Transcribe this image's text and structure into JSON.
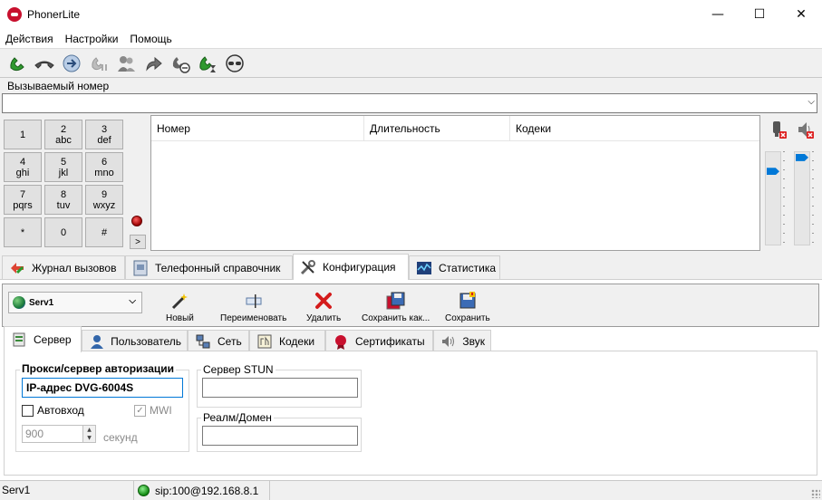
{
  "window": {
    "title": "PhonerLite",
    "minimize": "—",
    "maximize": "☐",
    "close": "✕"
  },
  "menu": [
    "Действия",
    "Настройки",
    "Помощь"
  ],
  "toolbar_icons": [
    "call-icon",
    "hangup-icon",
    "transfer-icon",
    "hold-icon",
    "conference-icon",
    "forward-icon",
    "reject-icon",
    "callback-icon",
    "mute-icon"
  ],
  "number_field": {
    "label": "Вызываемый номер",
    "value": ""
  },
  "keypad": [
    {
      "digit": "1",
      "letters": ""
    },
    {
      "digit": "2",
      "letters": "abc"
    },
    {
      "digit": "3",
      "letters": "def"
    },
    {
      "digit": "4",
      "letters": "ghi"
    },
    {
      "digit": "5",
      "letters": "jkl"
    },
    {
      "digit": "6",
      "letters": "mno"
    },
    {
      "digit": "7",
      "letters": "pqrs"
    },
    {
      "digit": "8",
      "letters": "tuv"
    },
    {
      "digit": "9",
      "letters": "wxyz"
    },
    {
      "digit": "*",
      "letters": ""
    },
    {
      "digit": "0",
      "letters": ""
    },
    {
      "digit": "#",
      "letters": ""
    }
  ],
  "more_button": ">",
  "call_list": {
    "columns": [
      "Номер",
      "Длительность",
      "Кодеки"
    ]
  },
  "volume": {
    "mic_level": 0.19,
    "speaker_level": 0.03
  },
  "main_tabs": [
    {
      "label": "Журнал вызовов",
      "icon": "call-log-icon"
    },
    {
      "label": "Телефонный справочник",
      "icon": "phonebook-icon"
    },
    {
      "label": "Конфигурация",
      "icon": "tools-icon"
    },
    {
      "label": "Статистика",
      "icon": "statistics-icon"
    }
  ],
  "config": {
    "server_select": "Serv1",
    "buttons": [
      "Новый",
      "Переименовать",
      "Удалить",
      "Сохранить как...",
      "Сохранить"
    ],
    "sub_tabs": [
      "Сервер",
      "Пользователь",
      "Сеть",
      "Кодеки",
      "Сертификаты",
      "Звук"
    ],
    "server": {
      "proxy_title": "Прокси/сервер авторизации",
      "proxy_value": "IP-адрес DVG-6004S",
      "autologin_label": "Автовход",
      "mwi_label": "MWI",
      "interval_value": "900",
      "interval_unit": "секунд",
      "stun_title": "Сервер STUN",
      "stun_value": "",
      "realm_title": "Реалм/Домен",
      "realm_value": ""
    }
  },
  "status": {
    "server": "Serv1",
    "account": "sip:100@192.168.8.1"
  }
}
